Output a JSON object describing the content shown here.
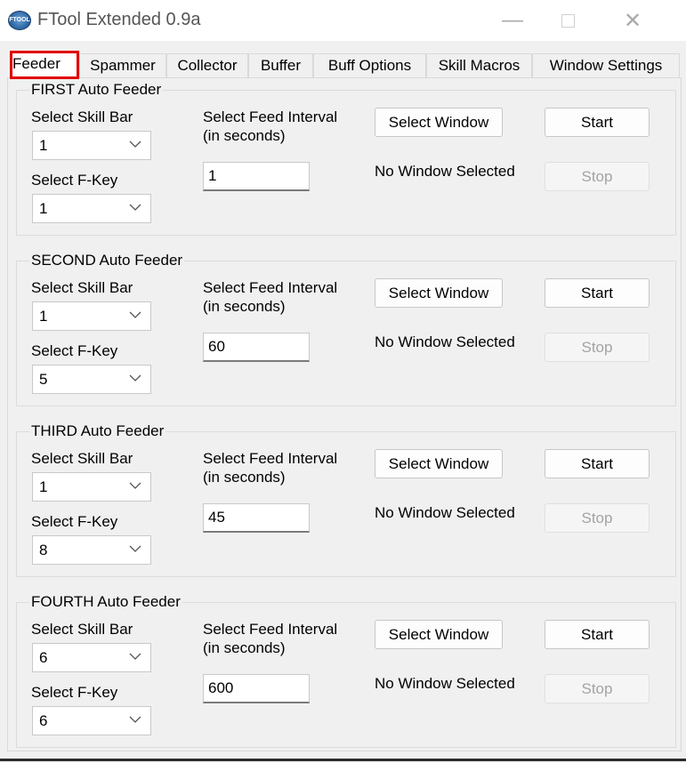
{
  "window": {
    "title": "FTool Extended 0.9a",
    "icon": "ftool-app-icon",
    "icon_text": "FTOOL",
    "controls": {
      "minimize": "—",
      "close": "✕"
    }
  },
  "tabs": [
    {
      "label": "Feeder",
      "active": true
    },
    {
      "label": "Spammer"
    },
    {
      "label": "Collector"
    },
    {
      "label": "Buffer"
    },
    {
      "label": "Buff Options"
    },
    {
      "label": "Skill Macros"
    },
    {
      "label": "Window Settings"
    }
  ],
  "groups": [
    {
      "title": "FIRST Auto Feeder",
      "skill_bar_label": "Select Skill Bar",
      "skill_bar": "1",
      "fkey_label": "Select F-Key",
      "fkey": "1",
      "interval_label_1": "Select Feed Interval",
      "interval_label_2": "(in seconds)",
      "interval": "1",
      "select_window": "Select Window",
      "status": "No Window Selected",
      "start": "Start",
      "stop": "Stop"
    },
    {
      "title": "SECOND Auto Feeder",
      "skill_bar_label": "Select Skill Bar",
      "skill_bar": "1",
      "fkey_label": "Select F-Key",
      "fkey": "5",
      "interval_label_1": "Select Feed Interval",
      "interval_label_2": "(in seconds)",
      "interval": "60",
      "select_window": "Select Window",
      "status": "No Window Selected",
      "start": "Start",
      "stop": "Stop"
    },
    {
      "title": "THIRD Auto Feeder",
      "skill_bar_label": "Select Skill Bar",
      "skill_bar": "1",
      "fkey_label": "Select F-Key",
      "fkey": "8",
      "interval_label_1": "Select Feed Interval",
      "interval_label_2": "(in seconds)",
      "interval": "45",
      "select_window": "Select Window",
      "status": "No Window Selected",
      "start": "Start",
      "stop": "Stop"
    },
    {
      "title": "FOURTH Auto Feeder",
      "skill_bar_label": "Select Skill Bar",
      "skill_bar": "6",
      "fkey_label": "Select F-Key",
      "fkey": "6",
      "interval_label_1": "Select Feed Interval",
      "interval_label_2": "(in seconds)",
      "interval": "600",
      "select_window": "Select Window",
      "status": "No Window Selected",
      "start": "Start",
      "stop": "Stop"
    }
  ],
  "colors": {
    "highlight": "#e00000",
    "disabled_text": "#a3a3a3",
    "background": "#f0f0f0"
  }
}
